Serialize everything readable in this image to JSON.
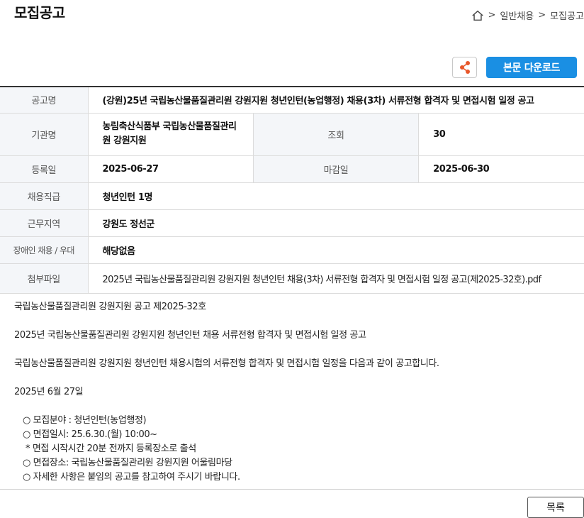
{
  "header": {
    "page_title": "모집공고",
    "breadcrumb": [
      ">",
      "일반채용",
      ">",
      "모집공고"
    ]
  },
  "actions": {
    "download_label": "본문 다운로드"
  },
  "info": {
    "labels": {
      "title": "공고명",
      "org": "기관명",
      "views": "조회",
      "registered": "등록일",
      "deadline": "마감일",
      "rank": "채용직급",
      "region": "근무지역",
      "disability": "장애인 채용 / 우대",
      "attachment": "첨부파일"
    },
    "values": {
      "title": "(강원)25년 국립농산물품질관리원 강원지원 청년인턴(농업행정) 채용(3차) 서류전형 합격자 및 면접시험 일정 공고",
      "org": "농림축산식품부 국립농산물품질관리원 강원지원",
      "views": "30",
      "registered": "2025-06-27",
      "deadline": "2025-06-30",
      "rank": "청년인턴 1명",
      "region": "강원도 정선군",
      "disability": "해당없음",
      "attachment": "2025년 국립농산물품질관리원 강원지원 청년인턴 채용(3차) 서류전형 합격자 및 면접시험 일정 공고(제2025-32호).pdf"
    }
  },
  "body": {
    "paragraphs": [
      "국립농산물품질관리원 강원지원 공고 제2025-32호",
      "2025년 국립농산물품질관리원 강원지원 청년인턴 채용 서류전형 합격자 및 면접시험 일정 공고",
      "국립농산물품질관리원 강원지원 청년인턴 채용시험의 서류전형 합격자 및 면접시험 일정을 다음과 같이 공고합니다.",
      "2025년 6월 27일"
    ],
    "items": [
      "○ 모집분야 : 청년인턴(농업행정)",
      "○ 면접일시: 25.6.30.(월) 10:00~",
      "* 면접 시작시간 20분 전까지 등록장소로 출석",
      "○ 면접장소: 국립농산물품질관리원 강원지원 어울림마당",
      "○ 자세한 사항은 붙임의 공고를 참고하여 주시기 바랍니다."
    ]
  },
  "footer": {
    "list_label": "목록"
  },
  "colors": {
    "accent": "#1a8fe3",
    "share_icon": "#e8572a",
    "table_header_bg": "#f4f6f9"
  },
  "icons": [
    "home-icon",
    "share-icon"
  ]
}
